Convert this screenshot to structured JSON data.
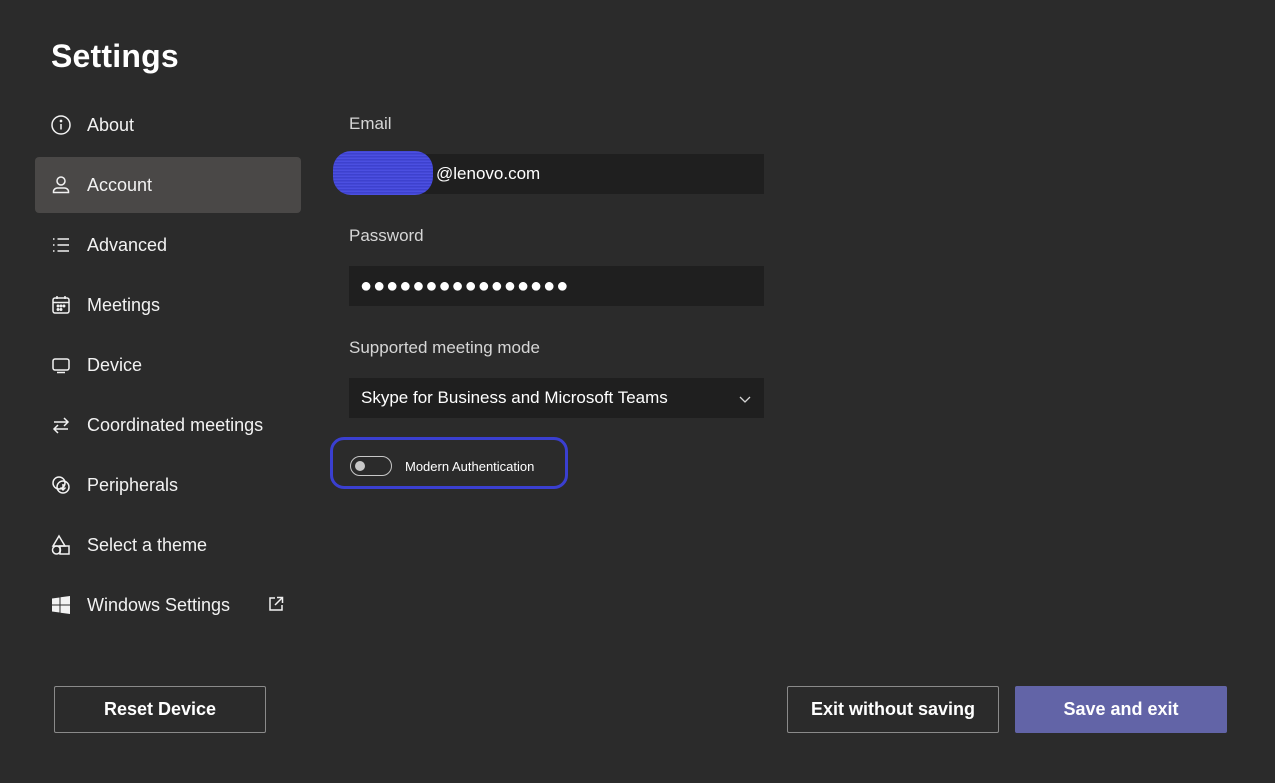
{
  "title": "Settings",
  "nav": {
    "items": [
      {
        "label": "About",
        "icon": "info-icon"
      },
      {
        "label": "Account",
        "icon": "person-icon",
        "active": true
      },
      {
        "label": "Advanced",
        "icon": "list-icon"
      },
      {
        "label": "Meetings",
        "icon": "calendar-icon"
      },
      {
        "label": "Device",
        "icon": "monitor-icon"
      },
      {
        "label": "Coordinated meetings",
        "icon": "arrows-swap-icon"
      },
      {
        "label": "Peripherals",
        "icon": "peripherals-icon"
      },
      {
        "label": "Select a theme",
        "icon": "shapes-icon"
      },
      {
        "label": "Windows Settings",
        "icon": "windows-logo-icon",
        "external_icon": "open-external-icon"
      }
    ]
  },
  "form": {
    "email_label": "Email",
    "email_value": "@lenovo.com",
    "password_label": "Password",
    "password_value": "●●●●●●●●●●●●●●●●",
    "meeting_mode_label": "Supported meeting mode",
    "meeting_mode_value": "Skype for Business and Microsoft Teams",
    "modern_auth_label": "Modern Authentication",
    "modern_auth_enabled": false
  },
  "buttons": {
    "reset": "Reset Device",
    "exit_no_save": "Exit without saving",
    "save_exit": "Save and exit"
  },
  "colors": {
    "background": "#2b2b2b",
    "active_nav": "#4a4847",
    "field_bg": "#1f1f1f",
    "primary": "#6264a7",
    "highlight": "#3a3fd0"
  }
}
